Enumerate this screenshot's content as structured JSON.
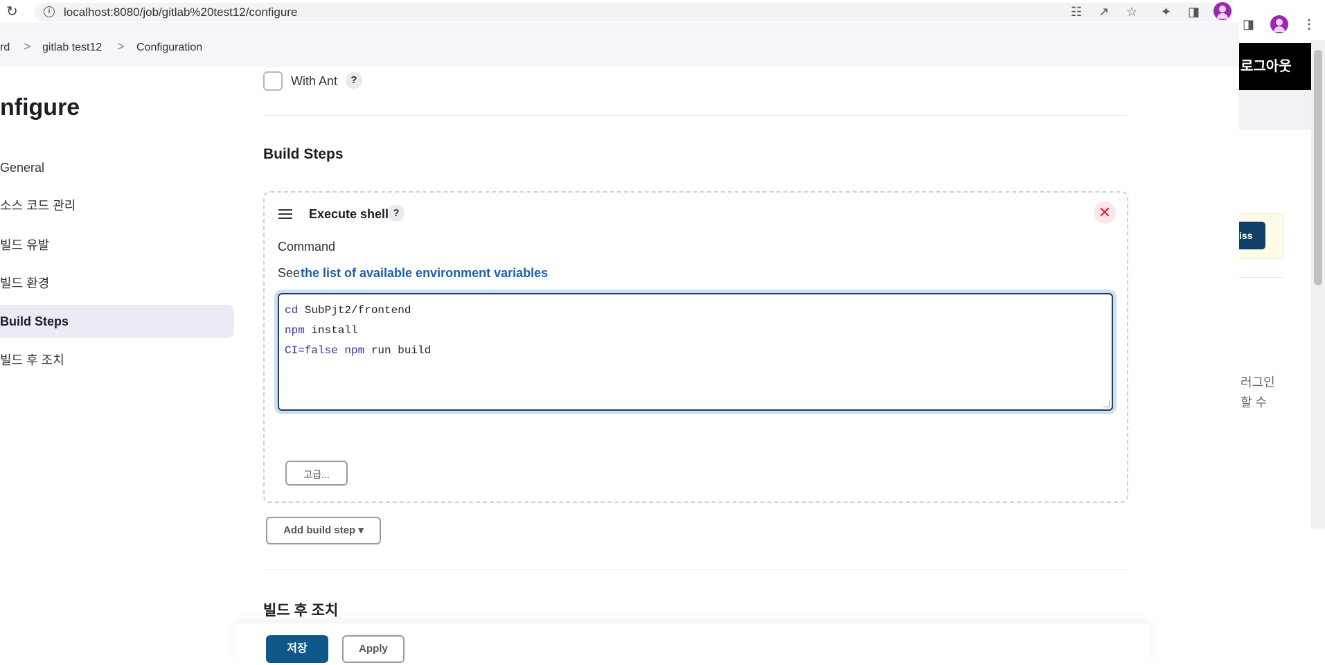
{
  "browser": {
    "url": "localhost:8080/job/gitlab%20test12/configure",
    "icons": [
      "reload-icon",
      "site-info-icon",
      "translate-icon",
      "share-icon",
      "bookmark-star-icon",
      "extensions-icon",
      "side-panel-icon",
      "profile-avatar",
      "menu-kebab-icon"
    ]
  },
  "breadcrumb": {
    "items": [
      "rd",
      "gitlab test12",
      "Configuration"
    ],
    "separator": ">"
  },
  "sidebar": {
    "title": "nfigure",
    "items": [
      {
        "label": "General"
      },
      {
        "label": "소스 코드 관리"
      },
      {
        "label": "빌드 유발"
      },
      {
        "label": "빌드 환경"
      },
      {
        "label": "Build Steps",
        "active": true
      },
      {
        "label": "빌드 후 조치"
      }
    ]
  },
  "build_env": {
    "with_ant_label": "With Ant",
    "with_ant_checked": false,
    "help": "?"
  },
  "build_steps": {
    "title": "Build Steps",
    "step": {
      "name": "Execute shell",
      "help": "?",
      "close": "✕",
      "command_label": "Command",
      "see_prefix": "See",
      "env_link": "the list of available environment variables",
      "command_lines": [
        {
          "kw": "cd",
          "rest": " SubPjt2/frontend"
        },
        {
          "kw": "npm",
          "rest": " install"
        },
        {
          "kw": "CI=false npm",
          "rest": " run build"
        }
      ],
      "advanced_button": "고급..."
    },
    "add_button": "Add build step",
    "add_caret": "▾"
  },
  "post_build": {
    "title": "빌드 후 조치"
  },
  "footer": {
    "save": "저장",
    "apply": "Apply"
  },
  "right_window": {
    "logout": "로그아웃",
    "dismiss_fragment": "iss",
    "text_line1": "러그인",
    "text_line2": "할 수"
  },
  "colors": {
    "primary": "#0f5788",
    "link": "#1a5fb4",
    "focus_ring": "#cde0f2",
    "active_nav": "#ebebf3",
    "close_red": "#d32030"
  }
}
